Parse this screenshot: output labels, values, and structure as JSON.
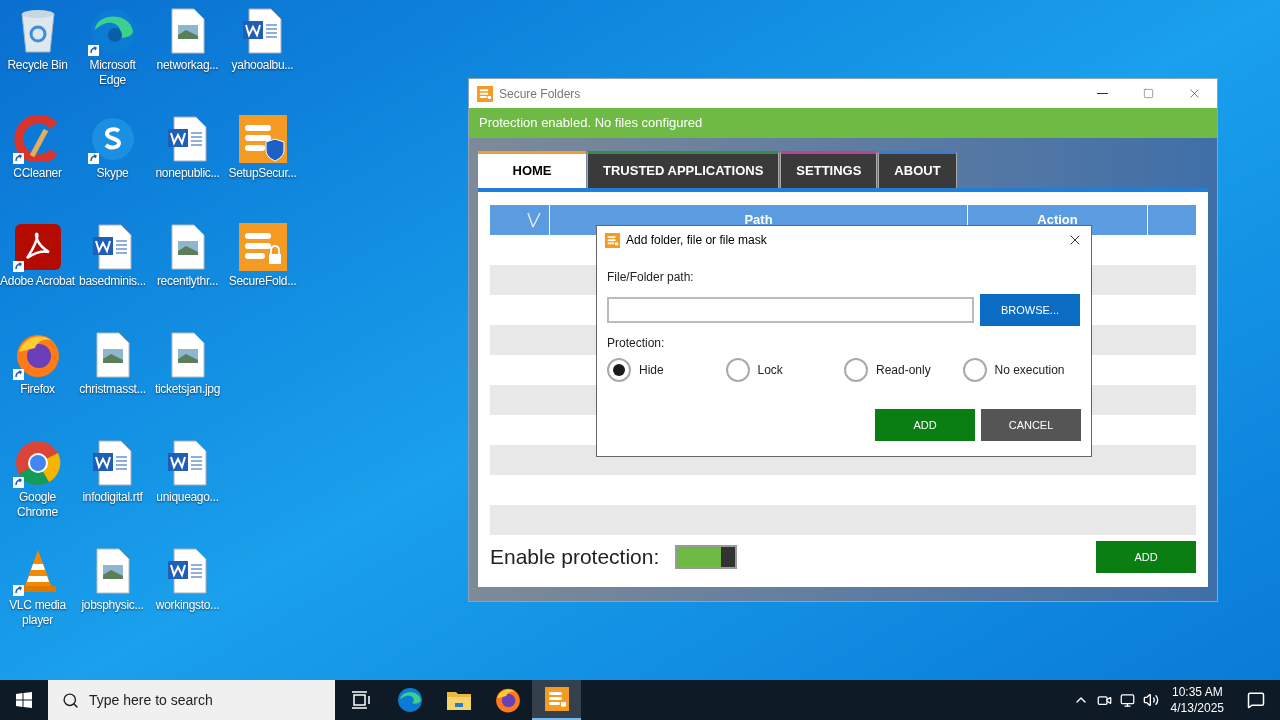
{
  "desktop_icons": [
    [
      {
        "label": "Recycle Bin",
        "kind": "recycle",
        "shortcut": false
      },
      {
        "label": "CCleaner",
        "kind": "ccleaner",
        "shortcut": true
      },
      {
        "label": "Adobe Acrobat",
        "kind": "acrobat",
        "shortcut": true
      },
      {
        "label": "Firefox",
        "kind": "firefox",
        "shortcut": true
      },
      {
        "label": "Google Chrome",
        "kind": "chrome",
        "shortcut": true
      },
      {
        "label": "VLC media player",
        "kind": "vlc",
        "shortcut": true
      }
    ],
    [
      {
        "label": "Microsoft Edge",
        "kind": "edge",
        "shortcut": true
      },
      {
        "label": "Skype",
        "kind": "skype",
        "shortcut": true
      },
      {
        "label": "basedminis...",
        "kind": "word",
        "shortcut": false
      },
      {
        "label": "christmasst...",
        "kind": "image",
        "shortcut": false
      },
      {
        "label": "infodigital.rtf",
        "kind": "word",
        "shortcut": false
      },
      {
        "label": "jobsphysic...",
        "kind": "image",
        "shortcut": false
      }
    ],
    [
      {
        "label": "networkag...",
        "kind": "image",
        "shortcut": false
      },
      {
        "label": "nonepublic...",
        "kind": "word",
        "shortcut": false
      },
      {
        "label": "recentlythr...",
        "kind": "image",
        "shortcut": false
      },
      {
        "label": "ticketsjan.jpg",
        "kind": "image",
        "shortcut": false
      },
      {
        "label": "uniqueago...",
        "kind": "word",
        "shortcut": false
      },
      {
        "label": "workingsto...",
        "kind": "word",
        "shortcut": false
      }
    ],
    [
      {
        "label": "yahooalbu...",
        "kind": "word",
        "shortcut": false
      },
      {
        "label": "SetupSecur...",
        "kind": "setup",
        "shortcut": false
      },
      {
        "label": "SecureFold...",
        "kind": "secure",
        "shortcut": false
      }
    ]
  ],
  "window": {
    "title": "Secure Folders",
    "status_text": "Protection enabled. No files configured",
    "tabs": [
      {
        "label": "HOME",
        "selected": true,
        "color": "#f0a030"
      },
      {
        "label": "TRUSTED APPLICATIONS",
        "selected": false,
        "color": "#3a8a4a"
      },
      {
        "label": "SETTINGS",
        "selected": false,
        "color": "#c04090"
      },
      {
        "label": "ABOUT",
        "selected": false,
        "color": "#3a7ad0"
      }
    ],
    "table": {
      "columns": [
        "Path",
        "Action"
      ]
    },
    "enable_protection": {
      "label": "Enable protection:",
      "on": true
    },
    "add_button": "ADD"
  },
  "dialog": {
    "title": "Add folder, file or file mask",
    "path_label": "File/Folder path:",
    "browse_button": "BROWSE...",
    "protection_label": "Protection:",
    "options": [
      {
        "label": "Hide",
        "selected": true
      },
      {
        "label": "Lock",
        "selected": false
      },
      {
        "label": "Read-only",
        "selected": false
      },
      {
        "label": "No execution",
        "selected": false
      }
    ],
    "add_button": "ADD",
    "cancel_button": "CANCEL"
  },
  "taskbar": {
    "search_placeholder": "Type here to search",
    "apps": [
      {
        "kind": "taskview",
        "active": false
      },
      {
        "kind": "edge",
        "active": false
      },
      {
        "kind": "folder",
        "active": false
      },
      {
        "kind": "firefox",
        "active": false
      },
      {
        "kind": "secure",
        "active": true
      }
    ],
    "time": "10:35 AM",
    "date": "4/13/2025"
  }
}
